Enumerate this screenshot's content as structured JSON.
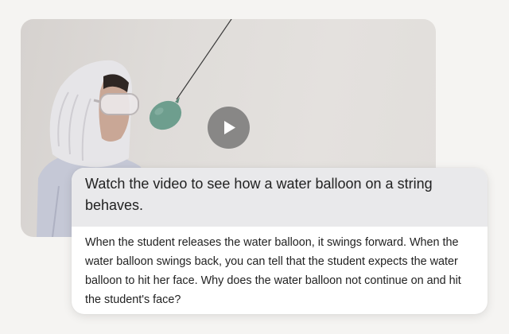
{
  "video": {
    "play_label": "▶",
    "accent_colors": {
      "balloon": "#6e9e8e",
      "play_button": "#6e6e6e"
    }
  },
  "prompt": {
    "text": "Watch the video to see how a water balloon on a string behaves."
  },
  "question": {
    "text": "When the student releases the water balloon, it swings forward. When the water balloon swings back, you can tell that the student expects the water balloon to hit her face. Why does the water balloon not continue on and hit the student's face?"
  }
}
